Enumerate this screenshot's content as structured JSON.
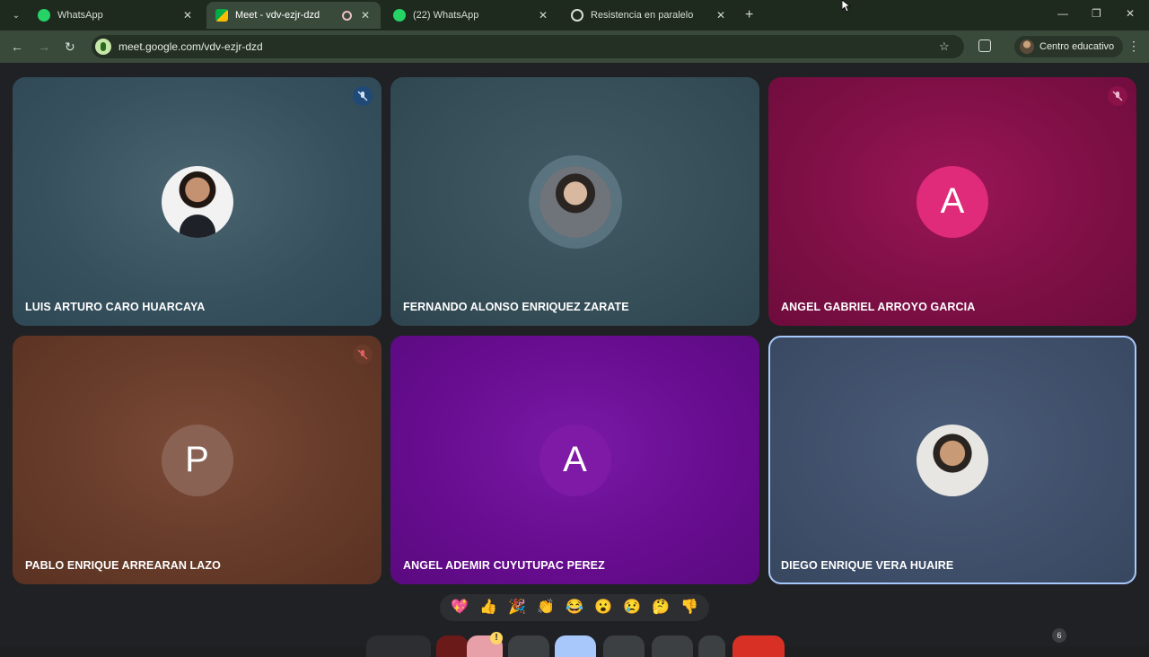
{
  "browser": {
    "tabs": [
      {
        "title": "WhatsApp",
        "icon": "whatsapp-icon",
        "active": false
      },
      {
        "title": "Meet - vdv-ezjr-dzd",
        "icon": "google-meet-icon",
        "active": true
      },
      {
        "title": "(22) WhatsApp",
        "icon": "whatsapp-icon",
        "active": false
      },
      {
        "title": "Resistencia en paralelo",
        "icon": "openai-icon",
        "active": false
      }
    ],
    "url": "meet.google.com/vdv-ezjr-dzd",
    "profile_label": "Centro educativo"
  },
  "meet": {
    "participants": [
      {
        "name": "LUIS ARTURO CARO HUARCAYA",
        "muted": true,
        "avatar": "photo"
      },
      {
        "name": "FERNANDO ALONSO ENRIQUEZ ZARATE",
        "muted": false,
        "avatar": "photo"
      },
      {
        "name": "ANGEL GABRIEL ARROYO GARCIA",
        "muted": true,
        "avatar": "letter",
        "letter": "A"
      },
      {
        "name": "PABLO ENRIQUE ARREARAN LAZO",
        "muted": true,
        "avatar": "letter",
        "letter": "P"
      },
      {
        "name": "ANGEL ADEMIR CUYUTUPAC PEREZ",
        "muted": false,
        "avatar": "letter",
        "letter": "A"
      },
      {
        "name": "DIEGO ENRIQUE VERA HUAIRE",
        "muted": false,
        "avatar": "photo",
        "speaking": true
      }
    ],
    "reactions": [
      "💖",
      "👍",
      "🎉",
      "👏",
      "😂",
      "😮",
      "😢",
      "🤔",
      "👎"
    ],
    "participant_count": "6"
  },
  "colors": {
    "tab_strip": "#1f2a1f",
    "toolbar": "#3a4a3a",
    "meet_bg": "#202124",
    "end_call": "#d93025"
  }
}
